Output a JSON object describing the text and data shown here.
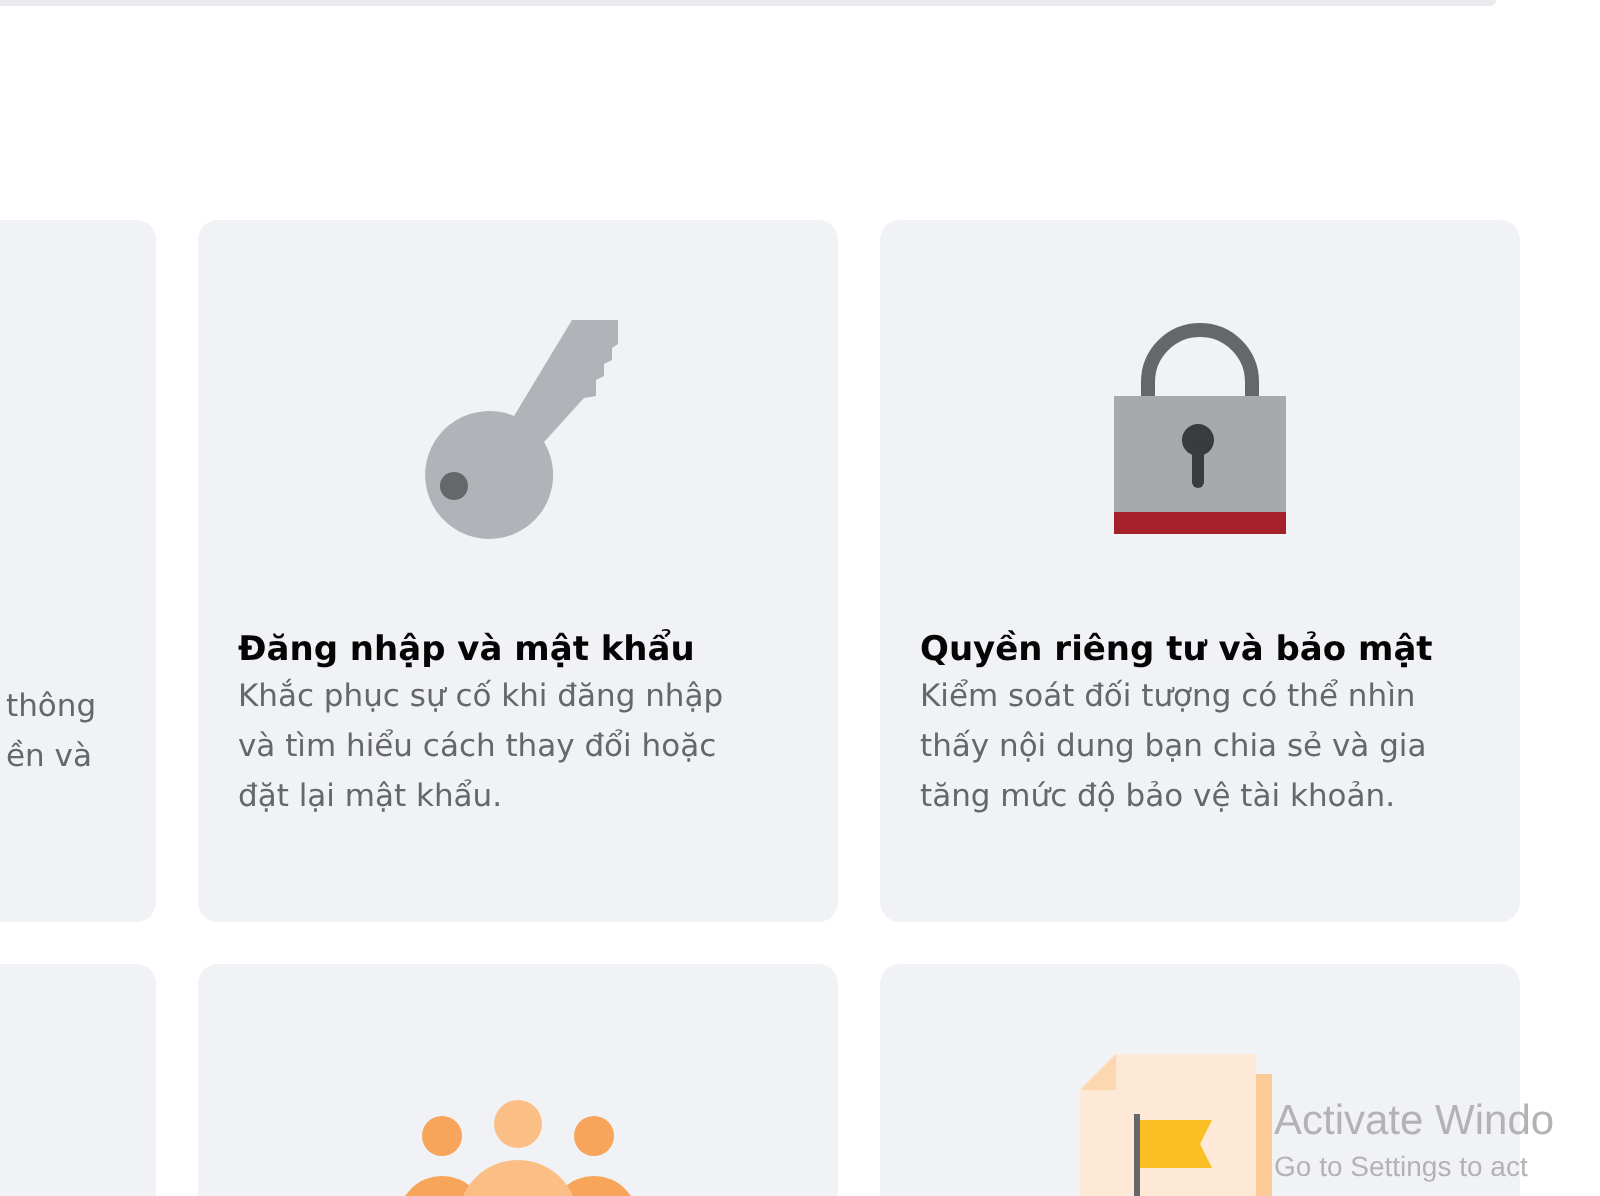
{
  "cards": [
    {
      "kind": "partial",
      "description_lines": [
        "thông",
        "ền và"
      ]
    },
    {
      "kind": "key",
      "title": "Đăng nhập và mật khẩu",
      "description": "Khắc phục sự cố khi đăng nhập và tìm hiểu cách thay đổi hoặc đặt lại mật khẩu."
    },
    {
      "kind": "lock",
      "title": "Quyền riêng tư và bảo mật",
      "description": "Kiểm soát đối tượng có thể nhìn thấy nội dung bạn chia sẻ và gia tăng mức độ bảo vệ tài khoản."
    },
    {
      "kind": "partial"
    },
    {
      "kind": "people"
    },
    {
      "kind": "flag-document"
    }
  ],
  "activation_notice": {
    "title": "Activate Windo",
    "subtitle": "Go to Settings to act"
  }
}
